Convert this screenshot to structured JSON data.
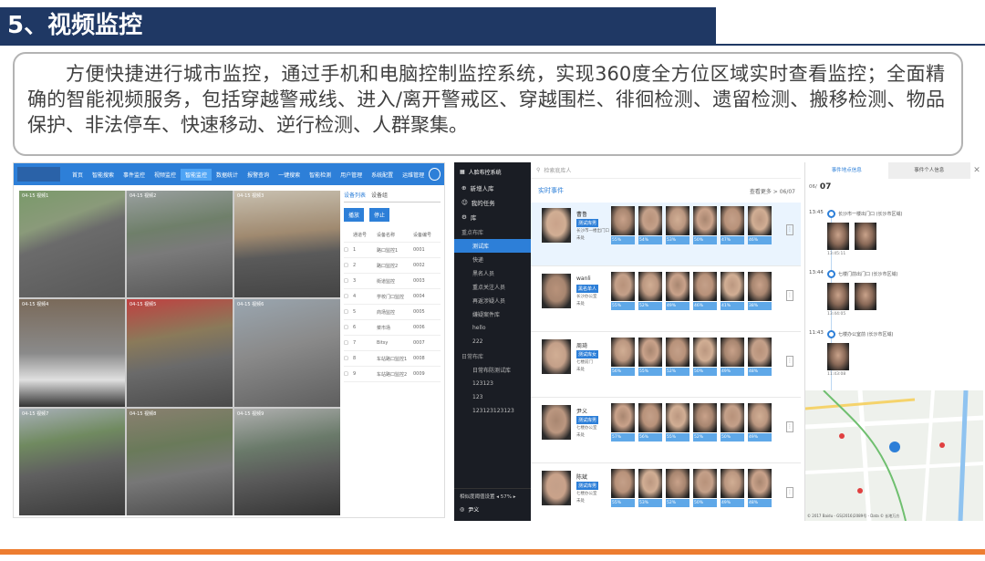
{
  "slide": {
    "title": "5、视频监控",
    "description": "方便快捷进行城市监控，通过手机和电脑控制监控系统，实现360度全方位区域实时查看监控；全面精确的智能视频服务，包括穿越警戒线、进入/离开警戒区、穿越围栏、徘徊检测、遗留检测、搬移检测、物品保护、非法停车、快速移动、逆行检测、人群聚集。"
  },
  "panel1": {
    "nav_items": [
      "首页",
      "智能搜索",
      "事件监控",
      "视频监控",
      "智能监控",
      "数据统计",
      "报警查询",
      "一键搜索",
      "智能检测",
      "用户管理",
      "系统配置",
      "运维管理"
    ],
    "active_index": 4,
    "cams": [
      "04-15 视频1",
      "04-15 视频2",
      "04-15 视频3",
      "04-15 视频4",
      "04-15 视频5",
      "04-15 视频6",
      "04-15 视频7",
      "04-15 视频8",
      "04-15 视频9"
    ],
    "side_tabs": [
      "设备列表",
      "设备组"
    ],
    "side_buttons": [
      "播放",
      "停止"
    ],
    "col_headers": [
      "",
      "通道号",
      "设备名称",
      "设备编号"
    ],
    "rows": [
      [
        "1",
        "路口监控1",
        "0001"
      ],
      [
        "2",
        "路口监控2",
        "0002"
      ],
      [
        "3",
        "街道监控",
        "0003"
      ],
      [
        "4",
        "学校门口监控",
        "0004"
      ],
      [
        "5",
        "商场监控",
        "0005"
      ],
      [
        "6",
        "菜市场",
        "0006"
      ],
      [
        "7",
        "Bitsy",
        "0007"
      ],
      [
        "8",
        "车站路口监控1",
        "0008"
      ],
      [
        "9",
        "车站路口监控2",
        "0009"
      ]
    ]
  },
  "panel2": {
    "system_name": "人脸布控系统",
    "menu": [
      {
        "label": "新增人库"
      },
      {
        "label": "我的任务"
      },
      {
        "label": "库"
      }
    ],
    "library_group1": "重点布库",
    "library_items1": [
      "测试库",
      "快递",
      "黑名人员",
      "重点关注人员",
      "再返涉疑人员",
      "嫌疑案件库",
      "hello",
      "222"
    ],
    "library_group2": "日常布库",
    "library_items2": [
      "日常布防测试库",
      "123123",
      "123",
      "123123123123"
    ],
    "footer_label": "相似度阈值设置",
    "footer_value": "57%",
    "user_name": "尹义",
    "search_placeholder": "检索底库人",
    "section_title": "实时事件",
    "section_right": "查看更多 > 06/07",
    "events": [
      {
        "name": "曹鲁",
        "tag": "测试库男",
        "loc": "长沙市一楼出门口",
        "state": "未处",
        "pcts": [
          "55%",
          "54%",
          "53%",
          "50%",
          "47%",
          "46%"
        ]
      },
      {
        "name": "wanli",
        "tag": "黑名单人",
        "loc": "长沙办公室",
        "state": "未处",
        "pcts": [
          "55%",
          "52%",
          "49%",
          "46%",
          "41%",
          "38%"
        ]
      },
      {
        "name": "周琦",
        "tag": "测试库女",
        "loc": "七楼前门",
        "state": "未处",
        "pcts": [
          "56%",
          "55%",
          "52%",
          "50%",
          "49%",
          "48%"
        ]
      },
      {
        "name": "尹义",
        "tag": "测试库男",
        "loc": "七楼办公室",
        "state": "未处",
        "pcts": [
          "57%",
          "56%",
          "55%",
          "52%",
          "50%",
          "49%"
        ]
      },
      {
        "name": "陈斌",
        "tag": "测试库男",
        "loc": "七楼办公室",
        "state": "未处",
        "pcts": [
          "55%",
          "53%",
          "52%",
          "50%",
          "49%",
          "48%"
        ]
      }
    ]
  },
  "panel3": {
    "tabs": [
      "事件地点信息",
      "事件个人信息"
    ],
    "date_label": "06/",
    "date_day": "07",
    "timeline": [
      {
        "time": "13:45",
        "place": "长沙市一楼出门口 (长沙市区域)",
        "sub": "13:45:11"
      },
      {
        "time": "13:44",
        "place": "七楼门前出门口 (长沙市区域)",
        "sub": "13:44:05"
      },
      {
        "time": "11:43",
        "place": "七楼办公室前 (长沙市区域)",
        "sub": "11:43:08"
      }
    ],
    "map_copyright": "© 2017 Baidu - GS(2016)2089号 - Data © 长地万方"
  }
}
